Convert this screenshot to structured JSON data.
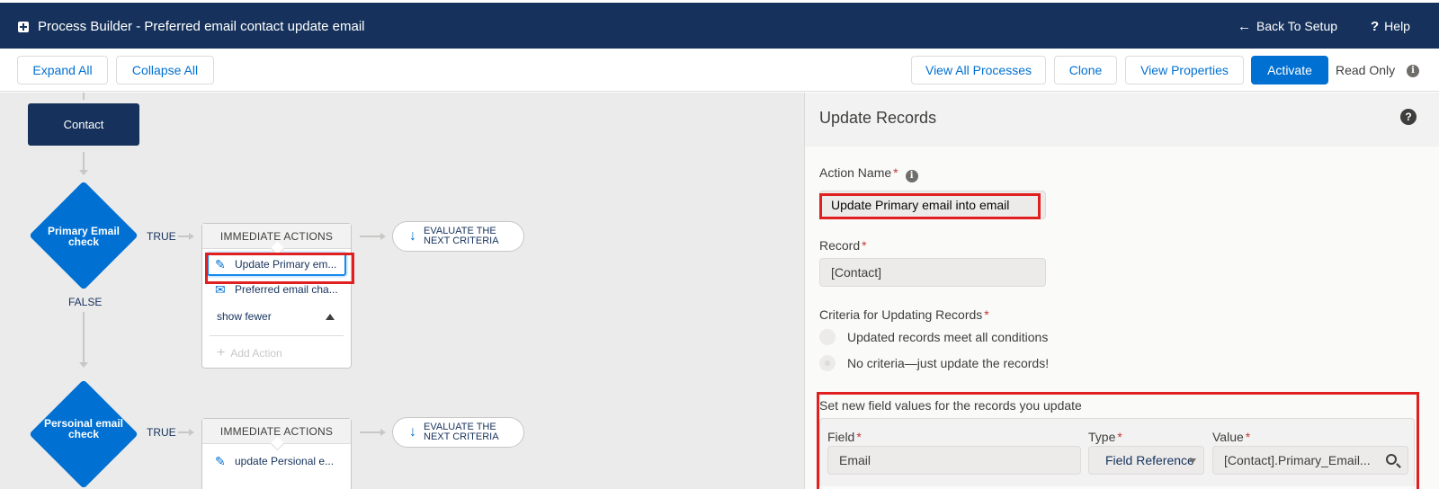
{
  "header": {
    "title": "Process Builder - Preferred email contact update email",
    "back_to_setup": "Back To Setup",
    "help": "Help",
    "back_icon": "arrow-left-icon",
    "help_icon": "question-icon",
    "app_icon": "process-builder-icon"
  },
  "toolbar": {
    "expand_all": "Expand All",
    "collapse_all": "Collapse All",
    "view_all_processes": "View All Processes",
    "clone": "Clone",
    "view_properties": "View Properties",
    "activate": "Activate",
    "read_only": "Read Only",
    "info_glyph": "i"
  },
  "canvas": {
    "object_node": "Contact",
    "criteria": [
      {
        "label": "Primary Email check",
        "true_label": "TRUE",
        "false_label": "FALSE",
        "actions_header": "IMMEDIATE ACTIONS",
        "actions": [
          {
            "label": "Update Primary em...",
            "icon": "pencil-icon",
            "selected": true
          },
          {
            "label": "Preferred email cha...",
            "icon": "email-icon",
            "selected": false
          }
        ],
        "show_fewer": "show fewer",
        "add_action": "Add Action",
        "evaluate_next": "EVALUATE THE\nNEXT CRITERIA"
      },
      {
        "label": "Persoinal email check",
        "true_label": "TRUE",
        "actions_header": "IMMEDIATE ACTIONS",
        "actions": [
          {
            "label": "update Persional e...",
            "icon": "pencil-icon",
            "selected": false
          }
        ],
        "evaluate_next": "EVALUATE THE\nNEXT CRITERIA"
      }
    ]
  },
  "panel": {
    "title": "Update Records",
    "help_glyph": "?",
    "action_name_label": "Action Name",
    "action_name_value": "Update Primary email into email",
    "record_label": "Record",
    "record_value": "[Contact]",
    "criteria_label": "Criteria for Updating Records",
    "criteria_options": [
      {
        "label": "Updated records meet all conditions",
        "checked": false
      },
      {
        "label": "No criteria—just update the records!",
        "checked": true
      }
    ],
    "set_fields_label": "Set new field values for the records you update",
    "field_col": "Field",
    "type_col": "Type",
    "value_col": "Value",
    "row": {
      "field": "Email",
      "type": "Field Reference",
      "value": "[Contact].Primary_Email..."
    }
  },
  "colors": {
    "header_bg": "#16325c",
    "brand": "#0070d2",
    "highlight": "#e02020"
  }
}
